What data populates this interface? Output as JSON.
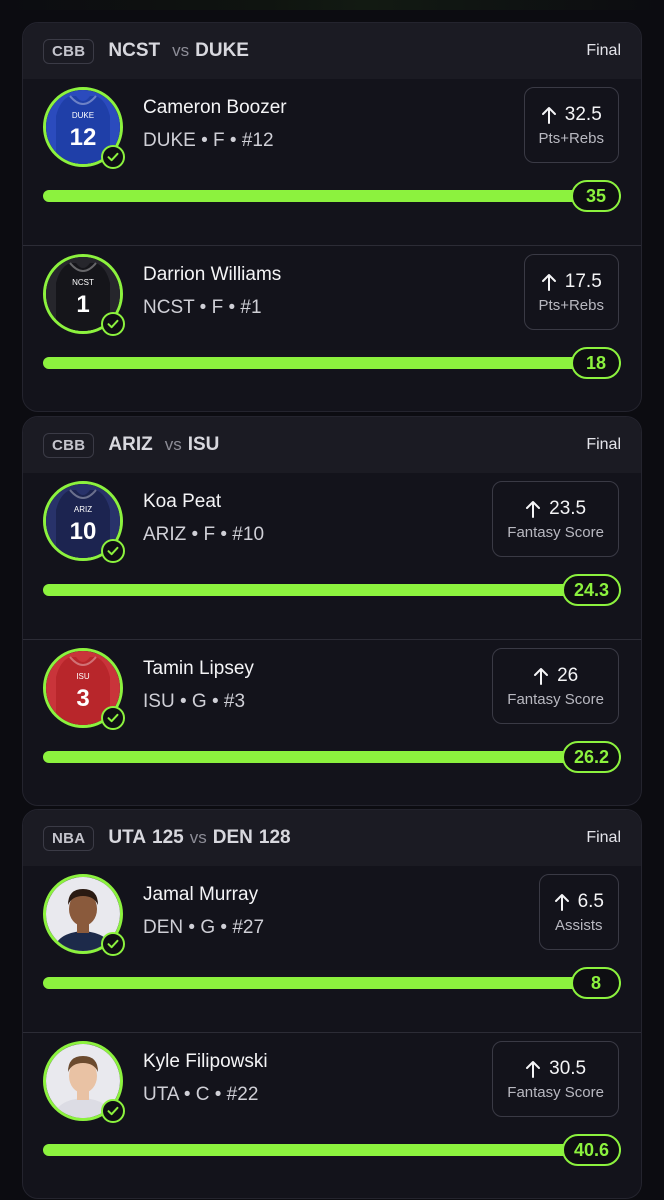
{
  "colors": {
    "accent": "#8cf23e",
    "card": "#13131b",
    "header": "#1b1b23"
  },
  "cards": [
    {
      "league": "CBB",
      "away_team": "NCST",
      "away_score": "",
      "vs": "vs",
      "home_team": "DUKE",
      "home_score": "",
      "status": "Final",
      "picks": [
        {
          "name": "Cameron Boozer",
          "meta": "DUKE • F • #12",
          "direction": "up",
          "line": "32.5",
          "stat": "Pts+Rebs",
          "result": "35",
          "progress": 1.0,
          "avatar": {
            "type": "jersey",
            "label": "DUKE",
            "number": "12",
            "color": "#1f3fa8",
            "bg": "#2b4bbd"
          }
        },
        {
          "name": "Darrion Williams",
          "meta": "NCST • F • #1",
          "direction": "up",
          "line": "17.5",
          "stat": "Pts+Rebs",
          "result": "18",
          "progress": 1.0,
          "avatar": {
            "type": "jersey",
            "label": "NCST",
            "number": "1",
            "color": "#15151a",
            "bg": "#26262c"
          }
        }
      ]
    },
    {
      "league": "CBB",
      "away_team": "ARIZ",
      "away_score": "",
      "vs": "vs",
      "home_team": "ISU",
      "home_score": "",
      "status": "Final",
      "picks": [
        {
          "name": "Koa Peat",
          "meta": "ARIZ • F • #10",
          "direction": "up",
          "line": "23.5",
          "stat": "Fantasy Score",
          "result": "24.3",
          "progress": 1.0,
          "avatar": {
            "type": "jersey",
            "label": "ARIZ",
            "number": "10",
            "color": "#1c2450",
            "bg": "#28326a"
          }
        },
        {
          "name": "Tamin Lipsey",
          "meta": "ISU • G • #3",
          "direction": "up",
          "line": "26",
          "stat": "Fantasy Score",
          "result": "26.2",
          "progress": 1.0,
          "avatar": {
            "type": "jersey",
            "label": "ISU",
            "number": "3",
            "color": "#b8262b",
            "bg": "#c9343a"
          }
        }
      ]
    },
    {
      "league": "NBA",
      "away_team": "UTA",
      "away_score": "125",
      "vs": "vs",
      "home_team": "DEN",
      "home_score": "128",
      "status": "Final",
      "picks": [
        {
          "name": "Jamal Murray",
          "meta": "DEN • G • #27",
          "direction": "up",
          "line": "6.5",
          "stat": "Assists",
          "result": "8",
          "progress": 1.0,
          "avatar": {
            "type": "photo",
            "skin": "#8a5a3c",
            "hair": "#2a1a12",
            "shirt": "#1d2a4a",
            "bg": "#e9e9ee"
          }
        },
        {
          "name": "Kyle Filipowski",
          "meta": "UTA • C • #22",
          "direction": "up",
          "line": "30.5",
          "stat": "Fantasy Score",
          "result": "40.6",
          "progress": 1.0,
          "avatar": {
            "type": "photo",
            "skin": "#e9c2a4",
            "hair": "#6b4a2e",
            "shirt": "#dcdce4",
            "bg": "#e9e9ee"
          }
        }
      ]
    }
  ]
}
